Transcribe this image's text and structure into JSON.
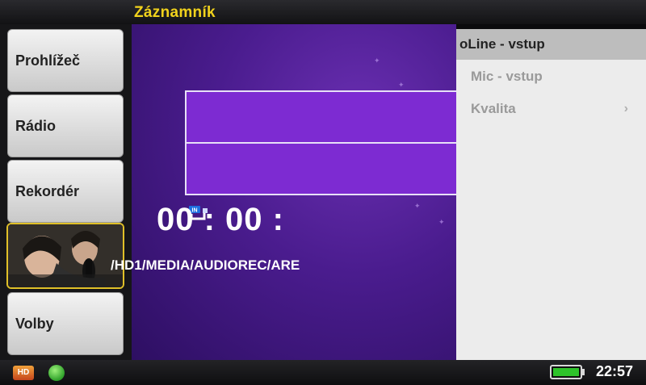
{
  "header": {
    "title": "Záznamník"
  },
  "sidebar": {
    "items": [
      {
        "label": "Prohlížeč"
      },
      {
        "label": "Rádio"
      },
      {
        "label": "Rekordér"
      },
      {
        "label": ""
      },
      {
        "label": "Volby"
      }
    ],
    "thumbnail_icon": "recording-singer-photo"
  },
  "recorder": {
    "input_icon": "line-in-icon",
    "input_badge": "IN",
    "timer": "00 : 00 :",
    "path": "/HD1/MEDIA/AUDIOREC/ARE"
  },
  "menu": {
    "items": [
      {
        "label": "Line - vstup",
        "marker": "o",
        "selected": true
      },
      {
        "label": "Mic - vstup",
        "selected": false
      },
      {
        "label": "Kvalita",
        "submenu": true,
        "selected": false
      }
    ],
    "submenu_glyph": "›"
  },
  "statusbar": {
    "hd_badge": "HD",
    "battery_level": 1.0,
    "clock": "22:57"
  },
  "colors": {
    "title": "#f1d21c",
    "content_bg": "#4a1c8e",
    "menu_bg": "#ececec",
    "menu_selected": "#bdbdbd",
    "battery": "#2ec32a"
  }
}
